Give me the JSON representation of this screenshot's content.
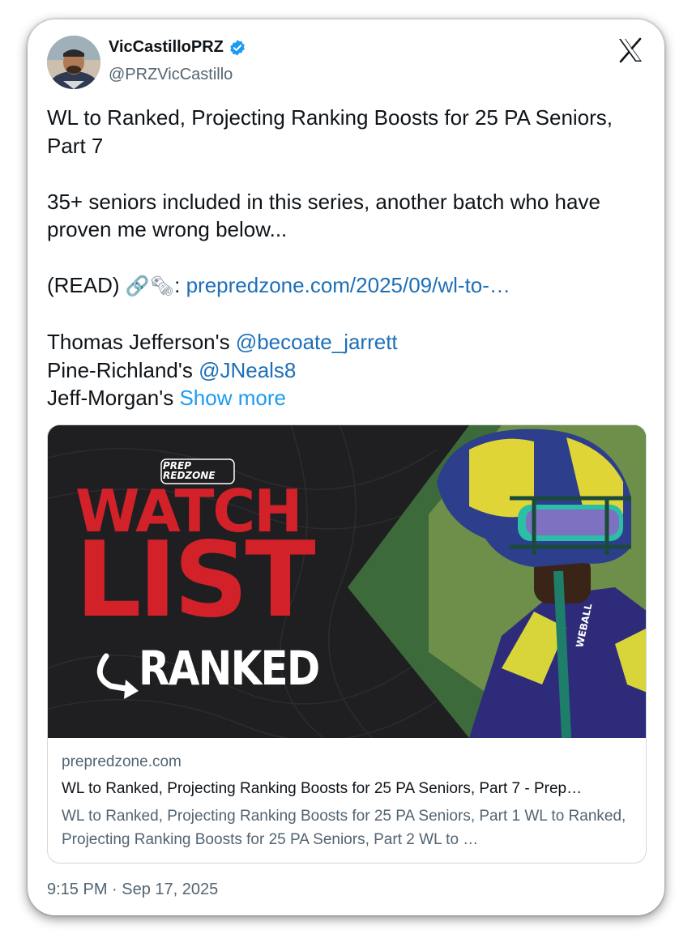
{
  "author": {
    "display_name": "VicCastilloPRZ",
    "handle": "@PRZVicCastillo",
    "verified": true,
    "avatar_icon": "avatar-photo"
  },
  "brand_icon": "x-logo-icon",
  "tweet": {
    "para1": "WL to Ranked, Projecting Ranking Boosts for 25 PA Seniors, Part 7",
    "para2": "35+ seniors included in this series, another batch who have proven me wrong below...",
    "read_prefix": "(READ) ",
    "read_emojis": "🔗🗞",
    "read_colon": ": ",
    "read_link": "prepredzone.com/2025/09/wl-to-…",
    "line1_text": "Thomas Jefferson's ",
    "line1_mention": "@becoate_jarrett",
    "line2_text": "Pine-Richland's ",
    "line2_mention": "@JNeals8",
    "line3_text": "Jeff-Morgan's ",
    "show_more": "Show more"
  },
  "link_card": {
    "image": {
      "brand_line1": "PREP",
      "brand_line2": "REDZONE",
      "title_line1": "WATCH",
      "title_line2": "LIST",
      "title_line3": "RANKED",
      "helmet_text": "WEBALL"
    },
    "domain": "prepredzone.com",
    "title": "WL to Ranked, Projecting Ranking Boosts for 25 PA Seniors, Part 7 - Prep…",
    "description": "WL to Ranked, Projecting Ranking Boosts for 25 PA Seniors, Part 1 WL to Ranked, Projecting Ranking Boosts for 25 PA Seniors, Part 2 WL to …"
  },
  "timestamp": "9:15 PM · Sep 17, 2025",
  "colors": {
    "link": "#1d6fb8",
    "show_more": "#1d9bf0",
    "verified": "#1d9bf0",
    "watch_list_red": "#d3212a",
    "image_bg": "#1f1f21"
  }
}
